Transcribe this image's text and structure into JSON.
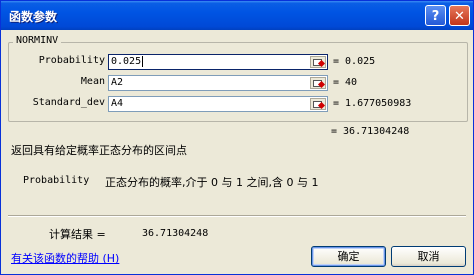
{
  "window": {
    "title": "函数参数",
    "help_button": "?",
    "close_button": "✕"
  },
  "function": {
    "name": "NORMINV",
    "args": [
      {
        "label": "Probability",
        "value": "0.025",
        "result": "= 0.025"
      },
      {
        "label": "Mean",
        "value": "A2",
        "result": "= 40"
      },
      {
        "label": "Standard_dev",
        "value": "A4",
        "result": "= 1.677050983"
      }
    ],
    "formula_result": "= 36.71304248",
    "description": "返回具有给定概率正态分布的区间点",
    "arg_help_name": "Probability",
    "arg_help_text": "正态分布的概率,介于 0 与 1 之间,含 0 与 1"
  },
  "calc": {
    "label": "计算结果 =",
    "value": "36.71304248"
  },
  "footer": {
    "help_link": "有关该函数的帮助 (H)",
    "ok_label": "确定",
    "cancel_label": "取消"
  },
  "icons": {
    "collapse": "collapse-dialog-icon"
  },
  "colors": {
    "titlebar": "#0054e3",
    "dialog_bg": "#ece9d8",
    "link": "#0000ff"
  }
}
